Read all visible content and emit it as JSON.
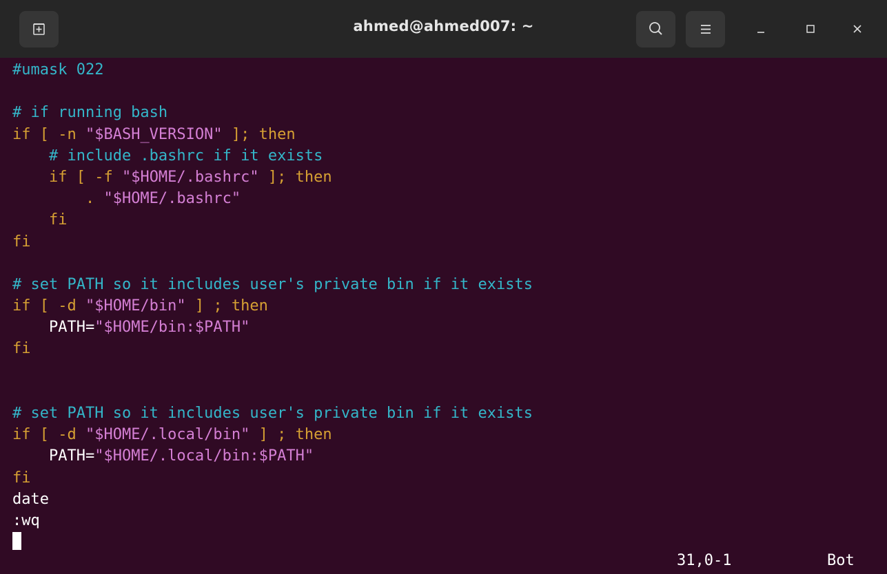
{
  "window": {
    "title": "ahmed@ahmed007: ~"
  },
  "titlebar": {
    "new_tab_icon": "new-tab-icon",
    "search_icon": "search-icon",
    "menu_icon": "hamburger-menu-icon",
    "minimize_icon": "minimize-icon",
    "maximize_icon": "maximize-icon",
    "close_icon": "close-icon"
  },
  "colors": {
    "background": "#300a24",
    "comment": "#34b6c9",
    "keyword": "#d6a033",
    "string": "#d47fd4",
    "text": "#ffffff"
  },
  "editor": {
    "lines": [
      [
        {
          "t": "cmt",
          "v": "#umask 022"
        }
      ],
      [],
      [
        {
          "t": "cmt",
          "v": "# if running bash"
        }
      ],
      [
        {
          "t": "kw",
          "v": "if [ -n "
        },
        {
          "t": "str",
          "v": "\"$BASH_VERSION\""
        },
        {
          "t": "kw",
          "v": " ]; then"
        }
      ],
      [
        {
          "t": "cmt",
          "v": "    # include .bashrc if it exists"
        }
      ],
      [
        {
          "t": "kw",
          "v": "    if [ -f "
        },
        {
          "t": "str",
          "v": "\"$HOME/.bashrc\""
        },
        {
          "t": "kw",
          "v": " ]; then"
        }
      ],
      [
        {
          "t": "kw",
          "v": "        . "
        },
        {
          "t": "str",
          "v": "\"$HOME/.bashrc\""
        }
      ],
      [
        {
          "t": "kw",
          "v": "    fi"
        }
      ],
      [
        {
          "t": "kw",
          "v": "fi"
        }
      ],
      [],
      [
        {
          "t": "cmt",
          "v": "# set PATH so it includes user's private bin if it exists"
        }
      ],
      [
        {
          "t": "kw",
          "v": "if [ -d "
        },
        {
          "t": "str",
          "v": "\"$HOME/bin\""
        },
        {
          "t": "kw",
          "v": " ] ; then"
        }
      ],
      [
        {
          "t": "txt",
          "v": "    PATH="
        },
        {
          "t": "str",
          "v": "\"$HOME/bin:$PATH\""
        }
      ],
      [
        {
          "t": "kw",
          "v": "fi"
        }
      ],
      [],
      [],
      [
        {
          "t": "cmt",
          "v": "# set PATH so it includes user's private bin if it exists"
        }
      ],
      [
        {
          "t": "kw",
          "v": "if [ -d "
        },
        {
          "t": "str",
          "v": "\"$HOME/.local/bin\""
        },
        {
          "t": "kw",
          "v": " ] ; then"
        }
      ],
      [
        {
          "t": "txt",
          "v": "    PATH="
        },
        {
          "t": "str",
          "v": "\"$HOME/.local/bin:$PATH\""
        }
      ],
      [
        {
          "t": "kw",
          "v": "fi"
        }
      ],
      [
        {
          "t": "txt",
          "v": "date"
        }
      ],
      [
        {
          "t": "txt",
          "v": ":wq"
        }
      ]
    ]
  },
  "statusline": {
    "position": "31,0-1",
    "scroll": "Bot"
  }
}
